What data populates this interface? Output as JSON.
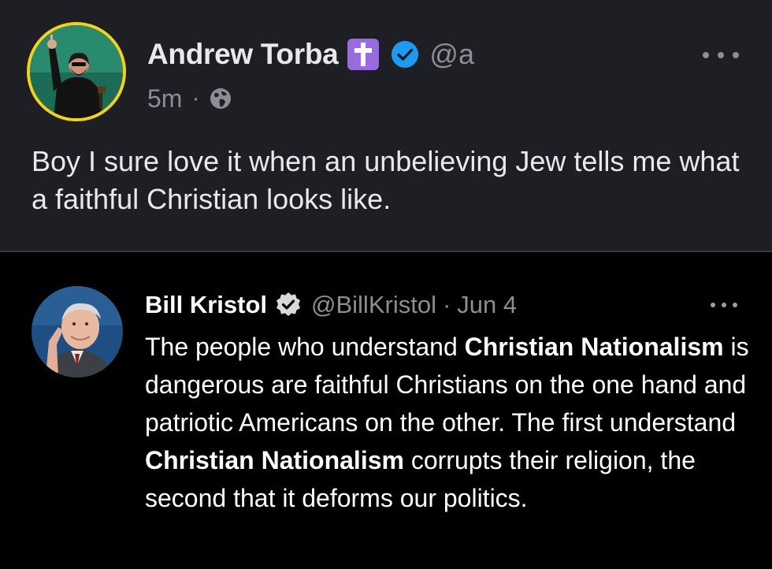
{
  "quote_post": {
    "author_name": "Andrew Torba",
    "handle": "@a",
    "time": "5m",
    "separator": "·",
    "text": "Boy I sure love it when an unbelieving Jew tells me what a faithful Christian looks like.",
    "icons": [
      "cross-emoji-icon",
      "verified-badge-icon",
      "globe-icon",
      "more-options-icon"
    ],
    "badge_color": "#9a6be0",
    "verified_color": "#1d9bf0",
    "avatar_ring_color": "#f2d21b"
  },
  "original_post": {
    "author_name": "Bill Kristol",
    "handle": "@BillKristol",
    "separator": "·",
    "date": "Jun 4",
    "text_parts": [
      "The people who understand ",
      "Christian Nationalism",
      " is dangerous are faithful Christians on the one hand and patriotic Americans on the other. The first understand ",
      "Christian Nationalism",
      " corrupts their religion, the second that it deforms our politics."
    ],
    "icons": [
      "verified-badge-icon",
      "more-options-icon"
    ]
  },
  "colors": {
    "top_background": "#1e1f24",
    "bottom_background": "#000000",
    "secondary_text": "#8b8e94"
  }
}
